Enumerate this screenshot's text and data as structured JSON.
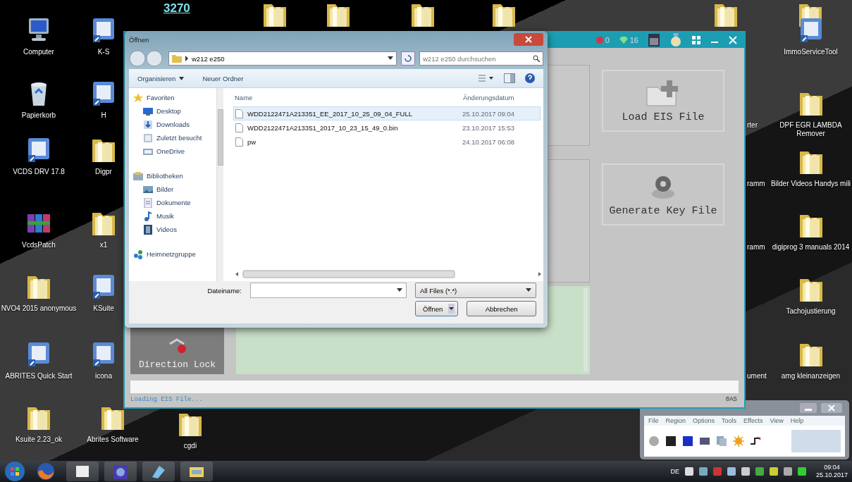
{
  "desktop": {
    "top_logo": "3270",
    "icons": [
      {
        "label": "Computer",
        "kind": "computer"
      },
      {
        "label": "Papierkorb",
        "kind": "recycle"
      },
      {
        "label": "VCDS DRV 17.8",
        "kind": "app"
      },
      {
        "label": "VcdsPatch",
        "kind": "archive"
      },
      {
        "label": "NVO4 2015 anonymous",
        "kind": "folder"
      },
      {
        "label": "ABRITES Quick Start",
        "kind": "app"
      },
      {
        "label": "Ksuite 2.23_ok",
        "kind": "folder"
      },
      {
        "label": "K-S",
        "kind": "app"
      },
      {
        "label": "H",
        "kind": "app"
      },
      {
        "label": "Digpr",
        "kind": "folder"
      },
      {
        "label": "x1",
        "kind": "folder"
      },
      {
        "label": "KSuite",
        "kind": "app"
      },
      {
        "label": "icona",
        "kind": "app"
      },
      {
        "label": "Abrites Software",
        "kind": "folder"
      },
      {
        "label": "cgdi",
        "kind": "folder"
      },
      {
        "label": "ImmoServiceTool",
        "kind": "app"
      },
      {
        "label": "DPF EGR LAMBDA Remover",
        "kind": "folder"
      },
      {
        "label": "Bilder Videos Handys mili",
        "kind": "folder"
      },
      {
        "label": "digiprog 3 manuals 2014",
        "kind": "folder"
      },
      {
        "label": "Tachojustierung",
        "kind": "folder"
      },
      {
        "label": "amg kleinanzeigen",
        "kind": "folder"
      },
      {
        "label": "rter",
        "kind": "hidden"
      },
      {
        "label": "ramm",
        "kind": "hidden"
      },
      {
        "label": "ramm",
        "kind": "hidden"
      },
      {
        "label": "ument",
        "kind": "hidden"
      }
    ]
  },
  "capture_window": {
    "menu": [
      "File",
      "Region",
      "Options",
      "Tools",
      "Effects",
      "View",
      "Help"
    ]
  },
  "app_window": {
    "badges": [
      "0",
      "16"
    ],
    "buttons": [
      {
        "label": "Load EIS File",
        "kind": "load"
      },
      {
        "label": "Generate Key File",
        "kind": "key"
      }
    ],
    "direction_lock": "Direction Lock",
    "progress": {
      "level": 0
    },
    "status": "Loading EIS File...",
    "status_right": "0AS"
  },
  "open_dialog": {
    "title": "Öffnen",
    "path": "w212 e250",
    "search_placeholder": "w212 e250 durchsuchen",
    "toolbar": [
      "Organisieren",
      "Neuer Ordner"
    ],
    "nav": [
      {
        "label": "Favoriten",
        "kind": "star",
        "children": [
          {
            "label": "Desktop",
            "kind": "desktop"
          },
          {
            "label": "Downloads",
            "kind": "download"
          },
          {
            "label": "Zuletzt besucht",
            "kind": "recent"
          },
          {
            "label": "OneDrive",
            "kind": "cloud"
          }
        ]
      },
      {
        "label": "Bibliotheken",
        "kind": "library",
        "children": [
          {
            "label": "Bilder",
            "kind": "pictures"
          },
          {
            "label": "Dokumente",
            "kind": "documents"
          },
          {
            "label": "Musik",
            "kind": "music"
          },
          {
            "label": "Videos",
            "kind": "videos"
          }
        ]
      },
      {
        "label": "Heimnetzgruppe",
        "kind": "homegroup"
      }
    ],
    "columns": [
      "Name",
      "Änderungsdatum"
    ],
    "files": [
      {
        "name": "WDD2122471A213351_EE_2017_10_25_09_04_FULL",
        "date": "25.10.2017 09:04",
        "selected": true
      },
      {
        "name": "WDD2122471A213351_2017_10_23_15_49_0.bin",
        "date": "23.10.2017 15:53",
        "selected": false
      },
      {
        "name": "pw",
        "date": "24.10.2017 06:08",
        "selected": false
      }
    ],
    "filename_label": "Dateiname:",
    "filter": "All Files (*.*)",
    "buttons": [
      "Öffnen",
      "Abbrechen"
    ]
  },
  "taskbar": {
    "language": "DE",
    "time": "09:04",
    "date": "25.10.2017"
  }
}
